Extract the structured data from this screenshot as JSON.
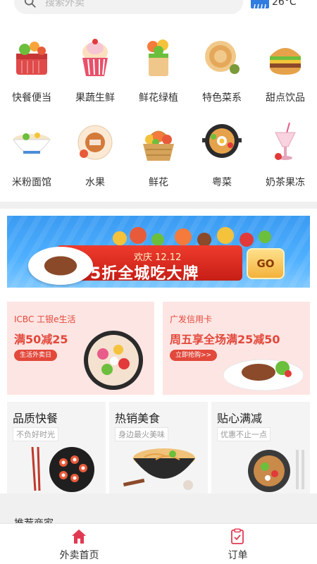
{
  "search": {
    "placeholder": "搜索外卖"
  },
  "weather": {
    "temp": "26°C"
  },
  "categories": [
    {
      "label": "快餐便当",
      "icon": "fast-food-basket-icon"
    },
    {
      "label": "果蔬生鲜",
      "icon": "cupcake-icon"
    },
    {
      "label": "鲜花绿植",
      "icon": "flower-pot-icon"
    },
    {
      "label": "特色菜系",
      "icon": "pancake-icon"
    },
    {
      "label": "甜点饮品",
      "icon": "burger-icon"
    },
    {
      "label": "米粉面馆",
      "icon": "noodle-bowl-icon"
    },
    {
      "label": "水果",
      "icon": "fruit-icon"
    },
    {
      "label": "鲜花",
      "icon": "flower-basket-icon"
    },
    {
      "label": "粤菜",
      "icon": "cantonese-dish-icon"
    },
    {
      "label": "奶茶果冻",
      "icon": "milk-tea-icon"
    }
  ],
  "banner": {
    "sub": "欢庆 12.12",
    "headline": "5折全城吃大牌",
    "go": "GO"
  },
  "promos": [
    {
      "bank": "ICBC 工银e生活",
      "offer": "满50减25",
      "button": "生活外卖日"
    },
    {
      "bank": "广发信用卡",
      "offer": "周五享全场满25减50",
      "button": "立即抢购>>"
    }
  ],
  "features": [
    {
      "title": "品质快餐",
      "sub": "不负好时光"
    },
    {
      "title": "热销美食",
      "sub": "身边最火美味"
    },
    {
      "title": "贴心满减",
      "sub": "优惠不止一点"
    }
  ],
  "section_peek": "推荐商家",
  "nav": [
    {
      "label": "外卖首页",
      "icon": "home-icon",
      "active_color": "#e03a52"
    },
    {
      "label": "订单",
      "icon": "order-icon",
      "active_color": "#e03a52"
    }
  ],
  "colors": {
    "accent": "#e2483b",
    "nav_active": "#e03a52",
    "banner_blue": "#3a9bf2"
  }
}
